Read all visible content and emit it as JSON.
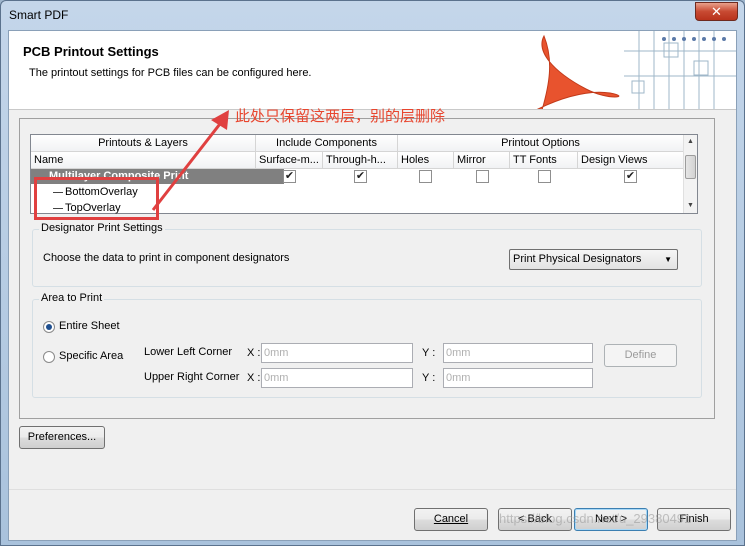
{
  "window": {
    "title": "Smart PDF",
    "close_glyph": "✕"
  },
  "header": {
    "title": "PCB Printout Settings",
    "subtitle": "The printout settings for PCB files can be configured here."
  },
  "grid": {
    "group_headers": [
      "Printouts & Layers",
      "Include Components",
      "Printout Options"
    ],
    "columns": [
      "Name",
      "Surface-m...",
      "Through-h...",
      "Holes",
      "Mirror",
      "TT Fonts",
      "Design Views"
    ],
    "rows": [
      {
        "name": "Multilayer Composite Print",
        "checks": [
          true,
          true,
          false,
          false,
          false,
          true
        ]
      },
      {
        "name": "BottomOverlay"
      },
      {
        "name": "TopOverlay"
      }
    ],
    "check_glyph": "✔"
  },
  "designator": {
    "group_label": "Designator Print Settings",
    "prompt": "Choose the data to print in component designators",
    "selected_option": "Print Physical Designators"
  },
  "area": {
    "group_label": "Area to Print",
    "entire_sheet_label": "Entire Sheet",
    "specific_area_label": "Specific Area",
    "entire_sheet_selected": true,
    "lower_left_label": "Lower Left Corner",
    "upper_right_label": "Upper Right Corner",
    "x_label": "X :",
    "y_label": "Y :",
    "placeholder": "0mm",
    "define_label": "Define"
  },
  "buttons": {
    "preferences": "Preferences...",
    "cancel": "Cancel",
    "back": "< Back",
    "next": "Next >",
    "finish": "Finish"
  },
  "annotation": {
    "text": "此处只保留这两层，别的层删除",
    "color": "#e8452e"
  },
  "watermark": "https://blog.csdn.net/u_29380491",
  "colors": {
    "accent": "#e8452e",
    "selection": "#808080"
  }
}
